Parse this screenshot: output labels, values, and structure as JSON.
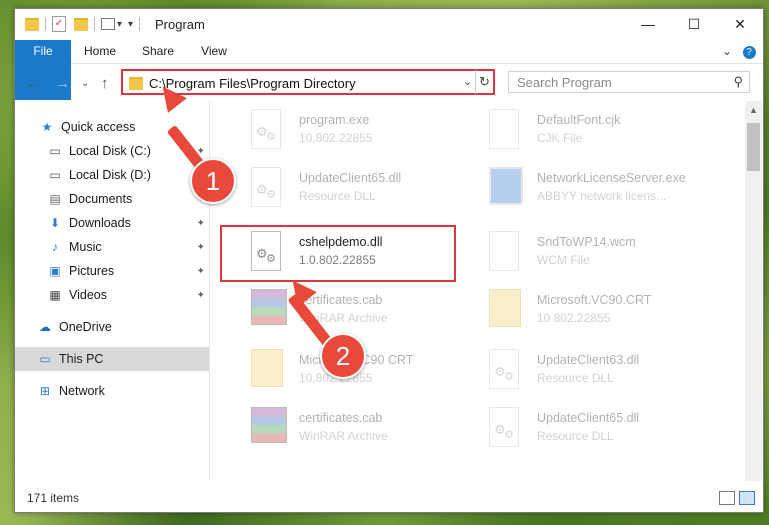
{
  "titlebar": {
    "title": "Program",
    "minimize": "—",
    "maximize": "☐",
    "close": "✕",
    "quick_access_dropdown": "▾"
  },
  "ribbon": {
    "tabs": [
      "File",
      "Home",
      "Share",
      "View"
    ],
    "expand": "⌄",
    "help": "?"
  },
  "address": {
    "back": "←",
    "forward": "→",
    "recent": "⌄",
    "up": "↑",
    "path": "C:\\Program Files\\Program Directory",
    "dropdown": "⌄",
    "refresh": "↻"
  },
  "search": {
    "placeholder": "Search Program",
    "icon": "⚲"
  },
  "navigation": {
    "items": [
      {
        "label": "Quick access",
        "icon": "star-icon",
        "glyph": "★",
        "color": "#2f7bd1",
        "pinned": false
      },
      {
        "label": "Local Disk (C:)",
        "icon": "drive-icon",
        "glyph": "▭",
        "color": "#555",
        "pinned": true
      },
      {
        "label": "Local Disk (D:)",
        "icon": "drive-icon",
        "glyph": "▭",
        "color": "#555",
        "pinned": true
      },
      {
        "label": "Documents",
        "icon": "documents-icon",
        "glyph": "▤",
        "color": "#666",
        "pinned": true
      },
      {
        "label": "Downloads",
        "icon": "downloads-icon",
        "glyph": "⬇",
        "color": "#2f7bd1",
        "pinned": true
      },
      {
        "label": "Music",
        "icon": "music-icon",
        "glyph": "♪",
        "color": "#2f7bd1",
        "pinned": true
      },
      {
        "label": "Pictures",
        "icon": "pictures-icon",
        "glyph": "▣",
        "color": "#2f7bd1",
        "pinned": true
      },
      {
        "label": "Videos",
        "icon": "videos-icon",
        "glyph": "▦",
        "color": "#444",
        "pinned": true
      },
      {
        "label": "OneDrive",
        "icon": "cloud-icon",
        "glyph": "☁",
        "color": "#1c6fc9",
        "pinned": false
      },
      {
        "label": "This PC",
        "icon": "computer-icon",
        "glyph": "▭",
        "color": "#2f7bd1",
        "pinned": false,
        "selected": true
      },
      {
        "label": "Network",
        "icon": "network-icon",
        "glyph": "⊞",
        "color": "#2f7bd1",
        "pinned": false
      }
    ],
    "pin_glyph": "📌"
  },
  "files": {
    "left": [
      {
        "name": "program.exe",
        "detail": "10.802.22855",
        "kind": "exe",
        "faded": true
      },
      {
        "name": "UpdateClient65.dll",
        "detail": "Resource DLL",
        "kind": "dll",
        "faded": true
      },
      {
        "name": "cshelpdemo.dll",
        "detail": "1.0.802.22855",
        "kind": "dll",
        "faded": false,
        "highlighted": true
      },
      {
        "name": "certificates.cab",
        "detail": "WinRAR Archive",
        "kind": "rar",
        "faded": true
      },
      {
        "name": "Microsoft VC90 CRT",
        "detail": "10.802.22855",
        "kind": "folder",
        "faded": true
      },
      {
        "name": "certificates.cab",
        "detail": "WinRAR Archive",
        "kind": "rar",
        "faded": true
      }
    ],
    "right": [
      {
        "name": "DefaultFont.cjk",
        "detail": "CJK File",
        "kind": "doc",
        "faded": true
      },
      {
        "name": "NetworkLicenseServer.exe",
        "detail": "ABBYY network licens...",
        "kind": "setup",
        "faded": true
      },
      {
        "name": "SndToWP14.wcm",
        "detail": "WCM File",
        "kind": "doc",
        "faded": true
      },
      {
        "name": "Microsoft.VC90.CRT",
        "detail": "10.802.22855",
        "kind": "folder",
        "faded": true
      },
      {
        "name": "UpdateClient63.dll",
        "detail": "Resource DLL",
        "kind": "dll",
        "faded": true
      },
      {
        "name": "UpdateClient65.dll",
        "detail": "Resource DLL",
        "kind": "dll",
        "faded": true
      }
    ]
  },
  "status": {
    "count": "171 items"
  },
  "callouts": {
    "step1": "1",
    "step2": "2",
    "color": "#e8493b"
  }
}
